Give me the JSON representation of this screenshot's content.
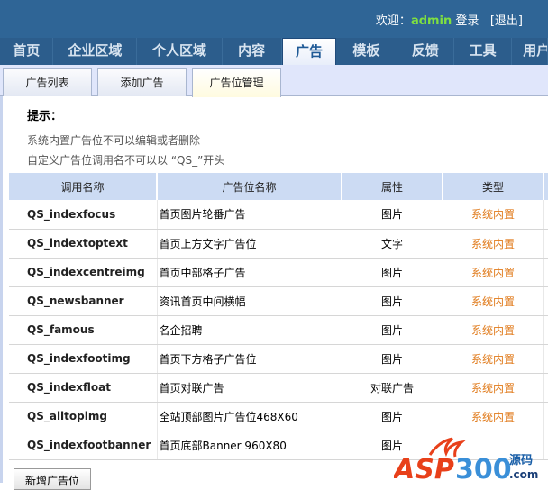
{
  "header": {
    "welcome": "欢迎：",
    "user": "admin",
    "login": "登录",
    "logout": "[退出]"
  },
  "nav": [
    "首页",
    "企业区域",
    "个人区域",
    "内容",
    "广告",
    "模板",
    "反馈",
    "工具",
    "用户"
  ],
  "tabs": [
    "广告列表",
    "添加广告",
    "广告位管理"
  ],
  "tips": {
    "title": "提示：",
    "lines": [
      "系统内置广告位不可以编辑或者删除",
      "自定义广告位调用名不可以以 “QS_”开头"
    ]
  },
  "table": {
    "headers": [
      "调用名称",
      "广告位名称",
      "属性",
      "类型"
    ],
    "rows": [
      [
        "QS_indexfocus",
        "首页图片轮番广告",
        "图片",
        "系统内置"
      ],
      [
        "QS_indextoptext",
        "首页上方文字广告位",
        "文字",
        "系统内置"
      ],
      [
        "QS_indexcentreimg",
        "首页中部格子广告",
        "图片",
        "系统内置"
      ],
      [
        "QS_newsbanner",
        "资讯首页中间横幅",
        "图片",
        "系统内置"
      ],
      [
        "QS_famous",
        "名企招聘",
        "图片",
        "系统内置"
      ],
      [
        "QS_indexfootimg",
        "首页下方格子广告位",
        "图片",
        "系统内置"
      ],
      [
        "QS_indexfloat",
        "首页对联广告",
        "对联广告",
        "系统内置"
      ],
      [
        "QS_alltopimg",
        "全站顶部图片广告位468X60",
        "图片",
        "系统内置"
      ],
      [
        "QS_indexfootbanner",
        "首页底部Banner 960X80",
        "图片",
        ""
      ]
    ]
  },
  "add_button": "新增广告位",
  "watermark": {
    "text": "ASP300",
    "sub": "源码",
    "domain": ".com"
  }
}
